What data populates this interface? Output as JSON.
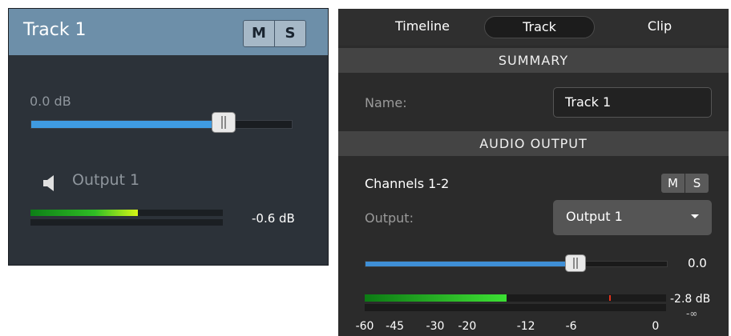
{
  "left_panel": {
    "track_title": "Track 1",
    "mute_label": "M",
    "solo_label": "S",
    "volume_db": "0.0 dB",
    "volume_fraction": 0.74,
    "output_label": "Output 1",
    "meter_level_fraction": 0.56,
    "meter_db": "-0.6 dB",
    "colors": {
      "header": "#6d8fa9",
      "body": "#2c3239",
      "slider_fill": "#3f9be1"
    },
    "icons": [
      "speaker-icon"
    ]
  },
  "right_panel": {
    "tabs": [
      {
        "label": "Timeline",
        "selected": false
      },
      {
        "label": "Track",
        "selected": true
      },
      {
        "label": "Clip",
        "selected": false
      }
    ],
    "summary": {
      "heading": "SUMMARY",
      "name_label": "Name:",
      "name_value": "Track 1"
    },
    "audio_output": {
      "heading": "AUDIO OUTPUT",
      "channels_label": "Channels 1-2",
      "mute_label": "M",
      "solo_label": "S",
      "output_label": "Output:",
      "output_value": "Output 1",
      "volume_fraction": 0.7,
      "volume_value": "0.0",
      "meter_level_fraction": 0.47,
      "peak_fraction": 0.81,
      "meter_db": "-2.8 dB",
      "meter_min": "-∞",
      "scale_ticks": [
        "-60",
        "-45",
        "-30",
        "-20",
        "-12",
        "-6",
        "0"
      ]
    },
    "colors": {
      "background": "#2b2b2b",
      "section": "#444444",
      "slider_fill": "#3f8fd6",
      "peak": "#e2331c"
    },
    "icons": [
      "dropdown-caret-icon"
    ]
  }
}
